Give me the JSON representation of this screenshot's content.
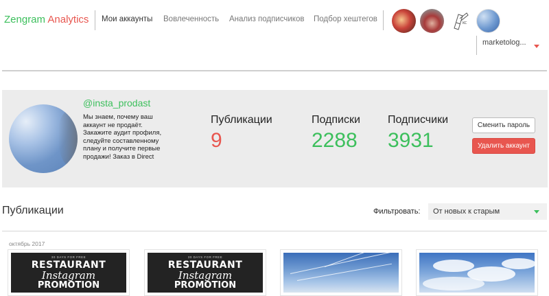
{
  "header": {
    "logo_part1": "Zengram",
    "logo_part2": "Analytics",
    "nav": [
      "Мои аккаунты",
      "Вовлеченность",
      "Анализ подписчиков",
      "Подбор хештегов"
    ],
    "user_dropdown": "marketolog...",
    "accent_green": "#3cbf5c",
    "accent_red": "#e8564f"
  },
  "profile": {
    "username": "@insta_prodast",
    "bio": "Мы знаем, почему ваш аккаунт не продаёт. Закажите аудит профиля, следуйте составленному плану и получите первые продажи! Заказ в Direct",
    "stats": [
      {
        "label": "Публикации",
        "value": "9",
        "color": "#e8564f"
      },
      {
        "label": "Подписки",
        "value": "2288",
        "color": "#3cbf5c"
      },
      {
        "label": "Подписчики",
        "value": "3931",
        "color": "#3cbf5c"
      }
    ],
    "change_password": "Сменить пароль",
    "delete_account": "Удалить аккаунт"
  },
  "publications": {
    "title": "Публикации",
    "filter_label": "Фильтровать:",
    "filter_value": "От новых к старым",
    "month": "октябрь 2017",
    "promo": {
      "small": "30 DAYS FOR FREE",
      "line1": "RESTAURANT",
      "line2": "Instagram",
      "line3": "PROMOTION"
    }
  }
}
